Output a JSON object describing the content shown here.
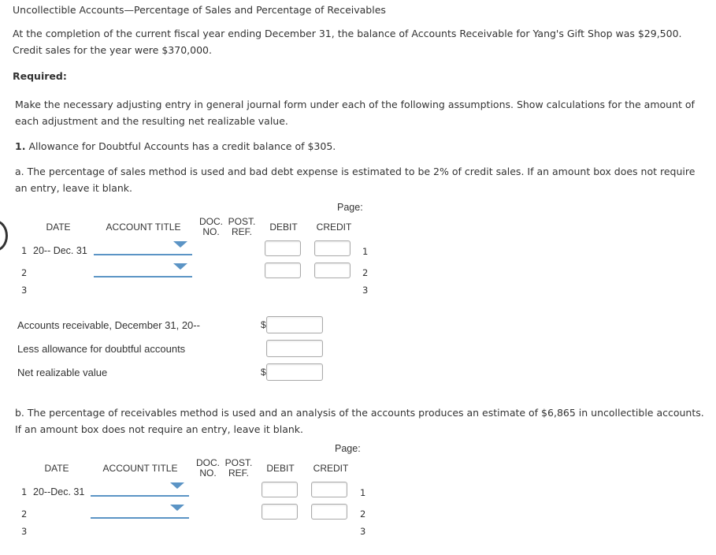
{
  "title": "Uncollectible Accounts—Percentage of Sales and Percentage of Receivables",
  "intro": "At the completion of the current fiscal year ending December 31, the balance of Accounts Receivable for Yang's Gift Shop was $29,500. Credit sales for the year were $370,000.",
  "required_label": "Required:",
  "instructions": "Make the necessary adjusting entry in general journal form under each of the following assumptions. Show calculations for the amount of each adjustment and the resulting net realizable value.",
  "question1": {
    "number": "1.",
    "text": "Allowance for Doubtful Accounts has a credit balance of $305."
  },
  "part_a": {
    "text": "a. The percentage of sales method is used and bad debt expense is estimated to be 2% of credit sales. If an amount box does not require an entry, leave it blank.",
    "journal": {
      "page_label": "Page:",
      "headers": {
        "date": "DATE",
        "account_title": "ACCOUNT TITLE",
        "doc_no_1": "DOC.",
        "doc_no_2": "NO.",
        "post_ref_1": "POST.",
        "post_ref_2": "REF.",
        "debit": "DEBIT",
        "credit": "CREDIT"
      },
      "rows": [
        {
          "num": "1",
          "date": "20-- Dec. 31",
          "account": "",
          "debit": "",
          "credit": ""
        },
        {
          "num": "2",
          "date": "",
          "account": "",
          "debit": "",
          "credit": ""
        },
        {
          "num": "3",
          "date": ""
        }
      ]
    },
    "nrv": {
      "rows": [
        {
          "label": "Accounts receivable, December 31, 20--",
          "currency": "$",
          "value": ""
        },
        {
          "label": "Less allowance for doubtful accounts",
          "currency": "",
          "value": ""
        },
        {
          "label": "Net realizable value",
          "currency": "$",
          "value": ""
        }
      ]
    }
  },
  "part_b": {
    "text": "b. The percentage of receivables method is used and an analysis of the accounts produces an estimate of $6,865 in uncollectible accounts. If an amount box does not require an entry, leave it blank.",
    "journal": {
      "page_label": "Page:",
      "headers": {
        "date": "DATE",
        "account_title": "ACCOUNT TITLE",
        "doc_no_1": "DOC.",
        "doc_no_2": "NO.",
        "post_ref_1": "POST.",
        "post_ref_2": "REF.",
        "debit": "DEBIT",
        "credit": "CREDIT"
      },
      "rows": [
        {
          "num": "1",
          "date": "20--Dec. 31",
          "account": "",
          "debit": "",
          "credit": ""
        },
        {
          "num": "2",
          "date": "",
          "account": "",
          "debit": "",
          "credit": ""
        },
        {
          "num": "3",
          "date": ""
        }
      ]
    }
  }
}
